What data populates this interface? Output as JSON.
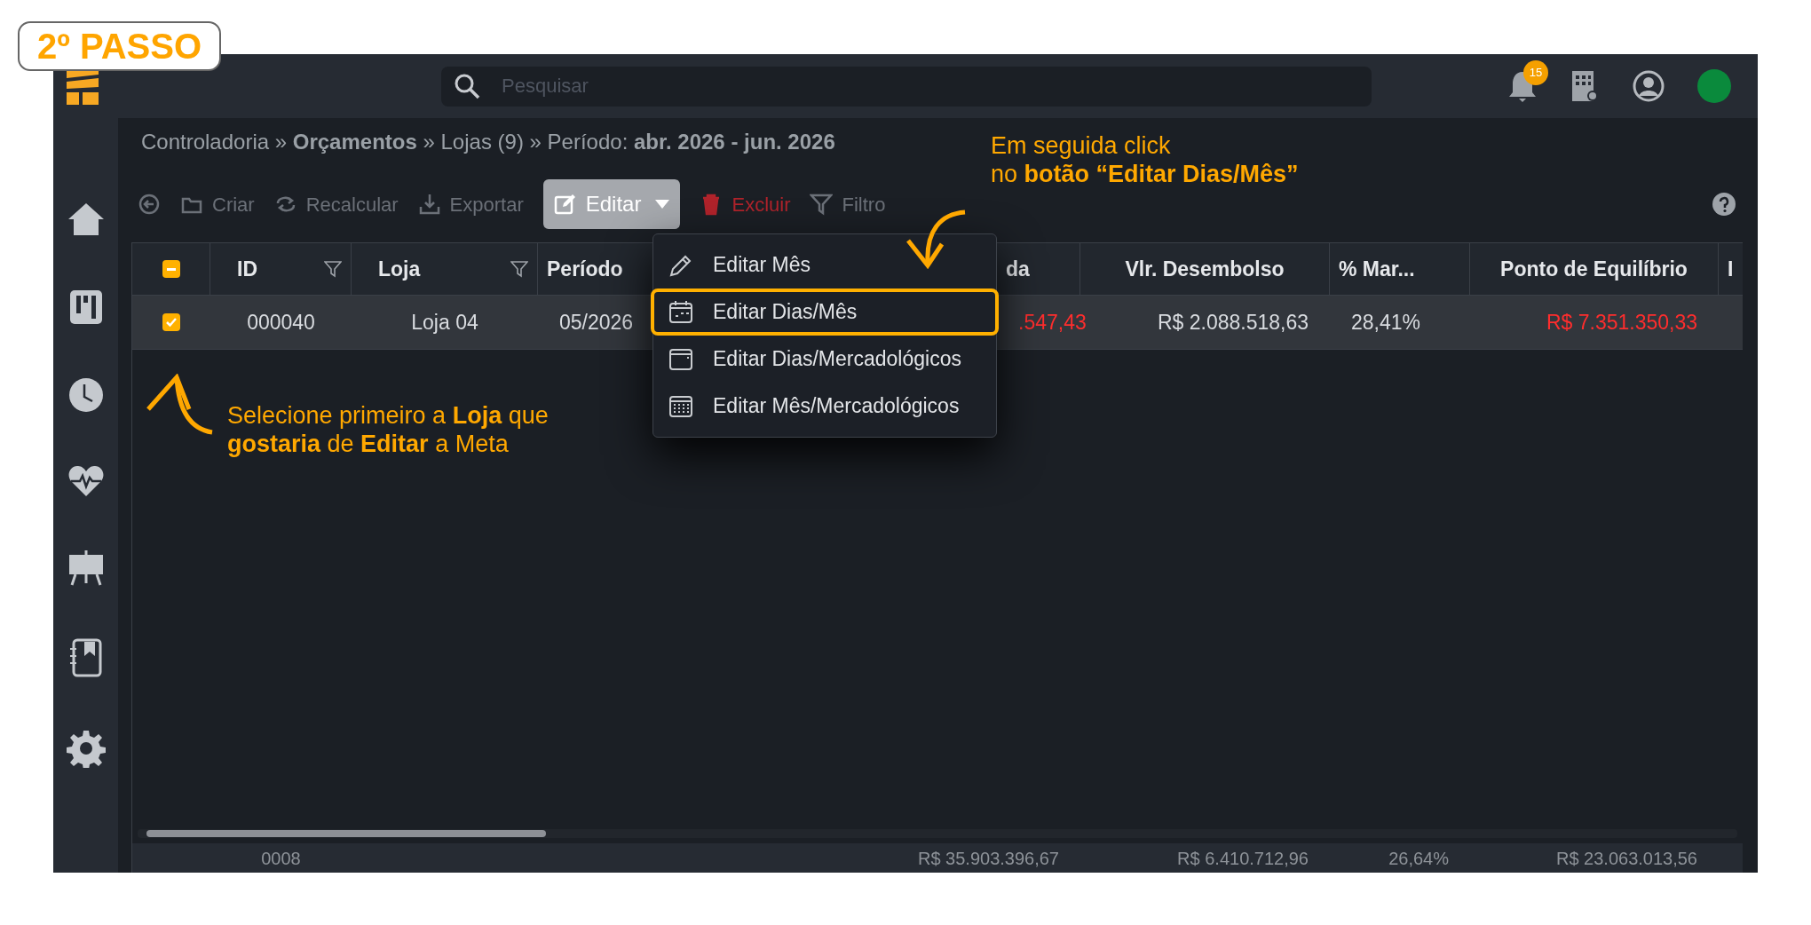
{
  "step_badge": "2º PASSO",
  "topbar": {
    "search": {
      "placeholder": "Pesquisar"
    },
    "notification_count": "15",
    "online": true
  },
  "breadcrumb": "Controladoria » **Orçamentos** » Lojas (9) » Período: **abr. 2026 - jun. 2026**",
  "toolbar": [
    {
      "kind": "back"
    },
    {
      "kind": "create",
      "label": "Criar"
    },
    {
      "kind": "recalc",
      "label": "Recalcular"
    },
    {
      "kind": "export",
      "label": "Exportar"
    },
    {
      "kind": "edit",
      "label": "Editar",
      "expanded": true
    },
    {
      "kind": "delete",
      "label": "Excluir"
    },
    {
      "kind": "filter",
      "label": "Filtro"
    }
  ],
  "table": {
    "header_indeterminate": true,
    "columns": [
      {
        "label": "ID",
        "filter": true
      },
      {
        "label": "Loja",
        "filter": true
      },
      {
        "label": "Período"
      },
      {
        "label": "da"
      },
      {
        "label": "Vlr. Desembolso"
      },
      {
        "label": "% Mar..."
      },
      {
        "label": "Ponto de Equilíbrio"
      },
      {
        "label": "I"
      }
    ],
    "rows": [
      {
        "checked": true,
        "selected": true,
        "cells": [
          {
            "text": "000040"
          },
          {
            "text": "Loja 04"
          },
          {
            "text": "05/2026"
          },
          {
            "text": ".547,43",
            "color": "#ff2d2d"
          },
          {
            "text": "R$ 2.088.518,63"
          },
          {
            "text": "28,41%"
          },
          {
            "text": "R$ 7.351.350,33",
            "color": "#ff2d2d"
          }
        ]
      }
    ],
    "footer": {
      "count": "0008",
      "totals": [
        "R$ 35.903.396,67",
        "R$ 6.410.712,96",
        "26,64%",
        "R$ 23.063.013,56"
      ]
    }
  },
  "menu": [
    {
      "kind": "pencil",
      "label": "Editar Mês",
      "selected": false
    },
    {
      "kind": "calendar",
      "label": "Editar Dias/Mês",
      "selected": true
    },
    {
      "kind": "window",
      "label": "Editar Dias/Mercadológicos",
      "selected": false
    },
    {
      "kind": "grid",
      "label": "Editar Mês/Mercadológicos",
      "selected": false
    }
  ],
  "annotations": [
    {
      "text": "Em seguida click\nno **botão “Editar Dias/Mês”**"
    },
    {
      "text": "Selecione primeiro a **Loja** que\n**gostaria** de **Editar** a Meta"
    }
  ]
}
